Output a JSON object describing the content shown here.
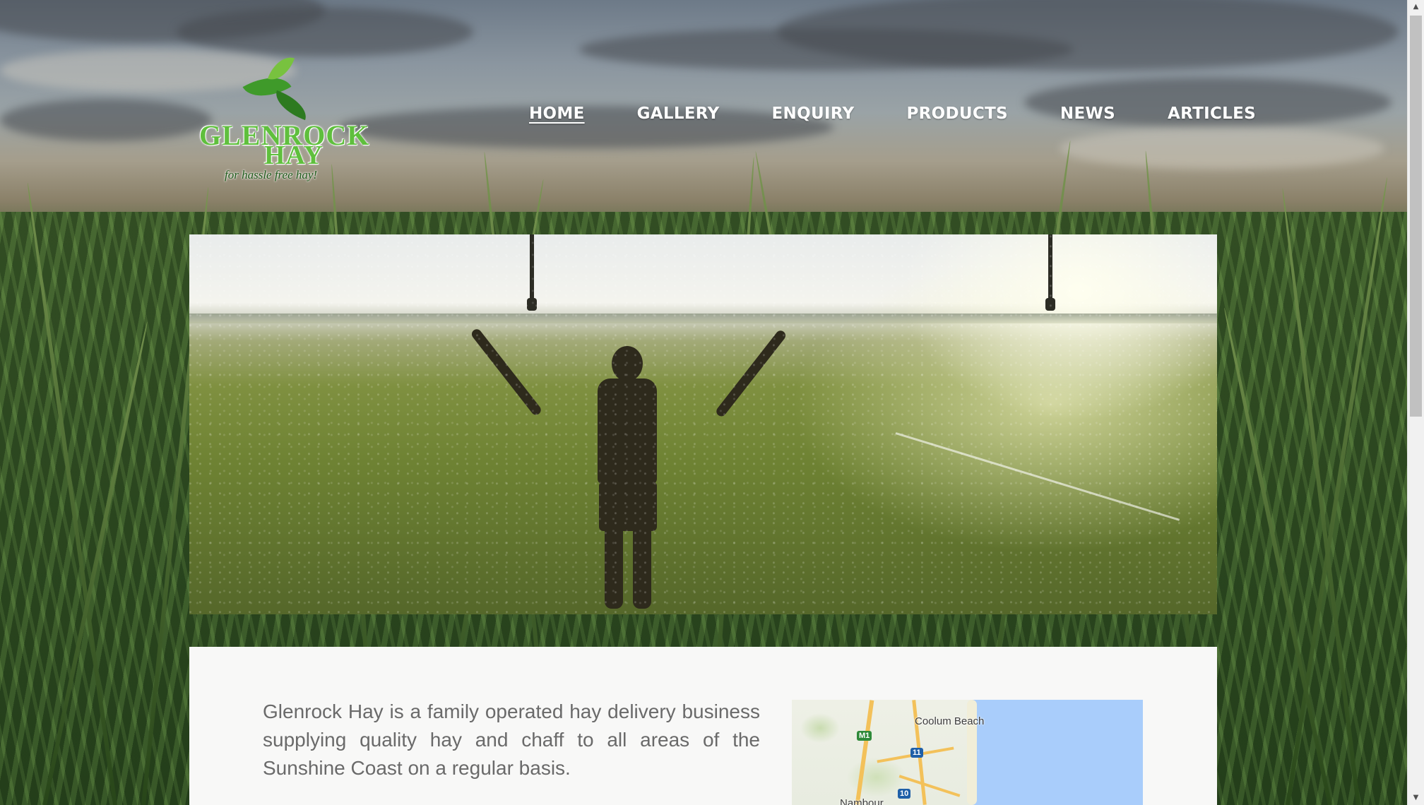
{
  "brand": {
    "logo_line1": "GLENROCK",
    "logo_line2": "HAY",
    "tagline": "for hassle free hay!"
  },
  "nav": {
    "items": [
      {
        "label": "HOME",
        "active": true
      },
      {
        "label": "GALLERY",
        "active": false
      },
      {
        "label": "ENQUIRY",
        "active": false
      },
      {
        "label": "PRODUCTS",
        "active": false
      },
      {
        "label": "NEWS",
        "active": false
      },
      {
        "label": "ARTICLES",
        "active": false
      }
    ]
  },
  "content": {
    "intro": "Glenrock Hay is a family operated hay delivery business supplying quality hay and chaff to all areas of the Sunshine Coast on a regular basis."
  },
  "map": {
    "labels": [
      "Coolum Beach",
      "Nambour"
    ],
    "shields": [
      "M1",
      "11",
      "10"
    ]
  },
  "colors": {
    "nav_text": "#ffffff",
    "logo_green": "#5fbf3d",
    "body_text": "#6a6a6a",
    "card_bg": "#f8f8f7",
    "map_sea": "#a9cdfb"
  }
}
